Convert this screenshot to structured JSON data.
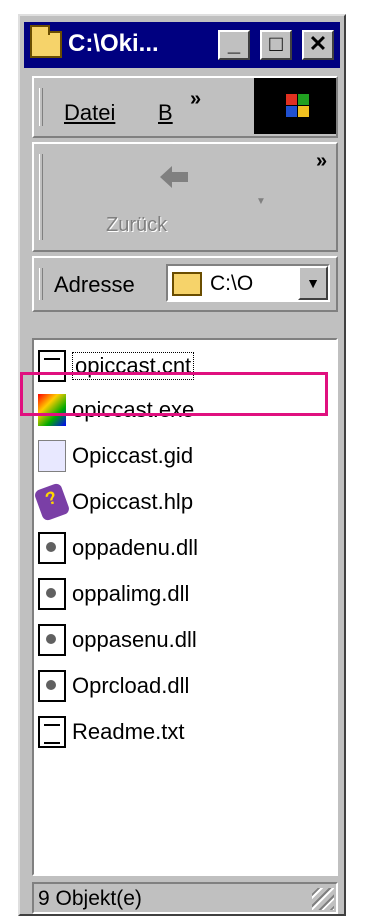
{
  "window": {
    "title": "C:\\Oki...",
    "minimize_label": "_",
    "maximize_label": "□",
    "close_label": "✕"
  },
  "menubar": {
    "items": [
      "Datei",
      "B"
    ],
    "overflow": "»"
  },
  "toolbar": {
    "back_label": "Zurück",
    "overflow": "»"
  },
  "address": {
    "label": "Adresse",
    "value": "C:\\O",
    "dropdown": "▼"
  },
  "files": [
    {
      "name": "opiccast.cnt",
      "icon": "document-icon"
    },
    {
      "name": "opiccast.exe",
      "icon": "exe-icon"
    },
    {
      "name": "Opiccast.gid",
      "icon": "gid-icon"
    },
    {
      "name": "Opiccast.hlp",
      "icon": "help-book-icon"
    },
    {
      "name": "oppadenu.dll",
      "icon": "dll-icon"
    },
    {
      "name": "oppalimg.dll",
      "icon": "dll-icon"
    },
    {
      "name": "oppasenu.dll",
      "icon": "dll-icon"
    },
    {
      "name": "Oprcload.dll",
      "icon": "dll-icon"
    },
    {
      "name": "Readme.txt",
      "icon": "text-file-icon"
    }
  ],
  "status": {
    "text": "9 Objekt(e)"
  },
  "colors": {
    "titlebar": "#000080",
    "highlight": "#e0107f",
    "face": "#c0c0c0"
  }
}
